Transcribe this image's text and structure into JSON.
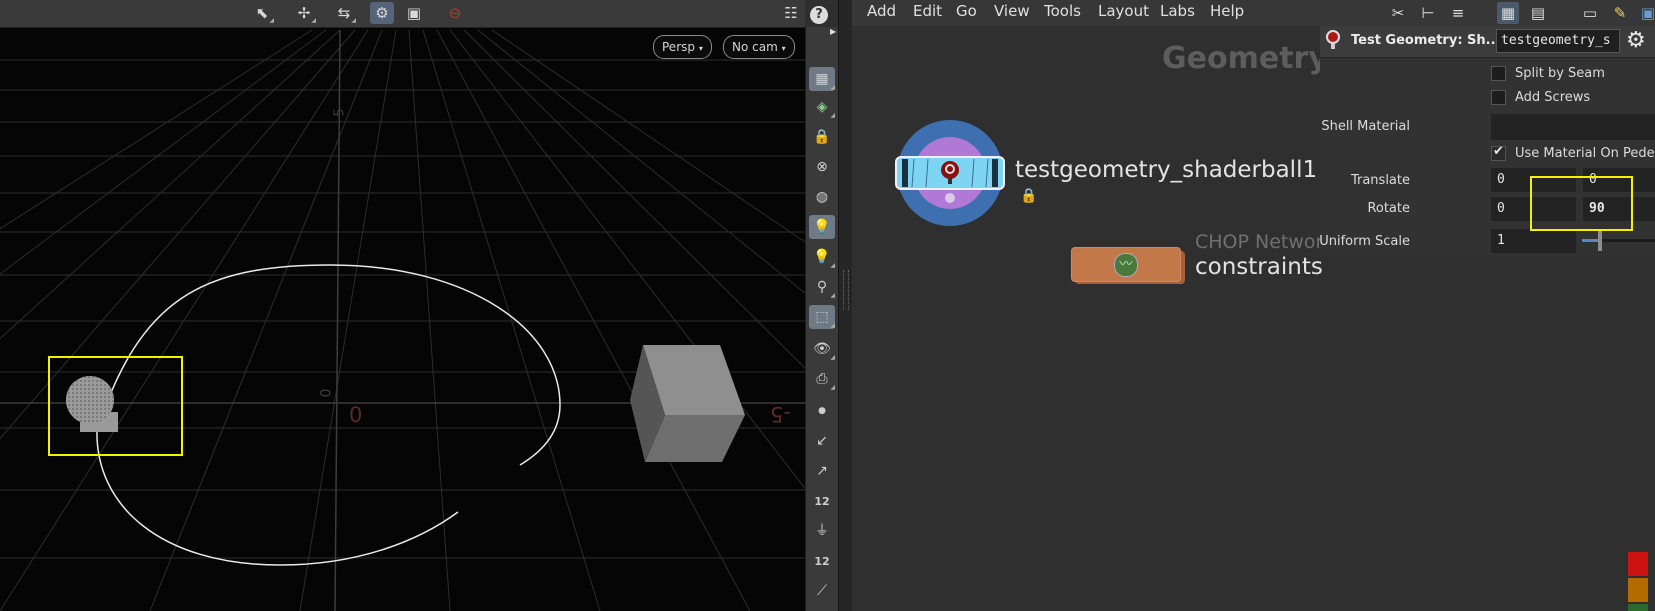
{
  "viewport": {
    "camera_view": "Persp",
    "camera": "No cam",
    "grid_labels": [
      "5",
      "0",
      "0",
      "-5"
    ]
  },
  "menubar": {
    "items": [
      "Add",
      "Edit",
      "Go",
      "View",
      "Tools",
      "Layout",
      "Labs",
      "Help"
    ]
  },
  "network": {
    "context_title": "Geometry",
    "node_name": "testgeometry_shaderball1",
    "chop_network_label": "CHOP Networ",
    "chop_node_name": "constraints"
  },
  "params": {
    "header_title": "Test Geometry: Sh...",
    "header_name": "testgeometry_s",
    "split_by_seam": "Split by Seam",
    "add_screws": "Add Screws",
    "shell_material_label": "Shell Material",
    "shell_material_value": "",
    "use_material_on_pedestal": "Use Material On Pedest",
    "translate_label": "Translate",
    "translate_x": "0",
    "translate_y": "0",
    "rotate_label": "Rotate",
    "rotate_x": "0",
    "rotate_y": "90",
    "uniform_scale_label": "Uniform Scale",
    "uniform_scale_value": "1"
  },
  "sidebar_labels": [
    "12",
    "12"
  ],
  "colors": {
    "highlight": "#f3f300",
    "node_blue": "#7ed4f3",
    "chop_orange": "#c3784a",
    "status_red": "#cc1111",
    "status_orange": "#b36b00"
  }
}
